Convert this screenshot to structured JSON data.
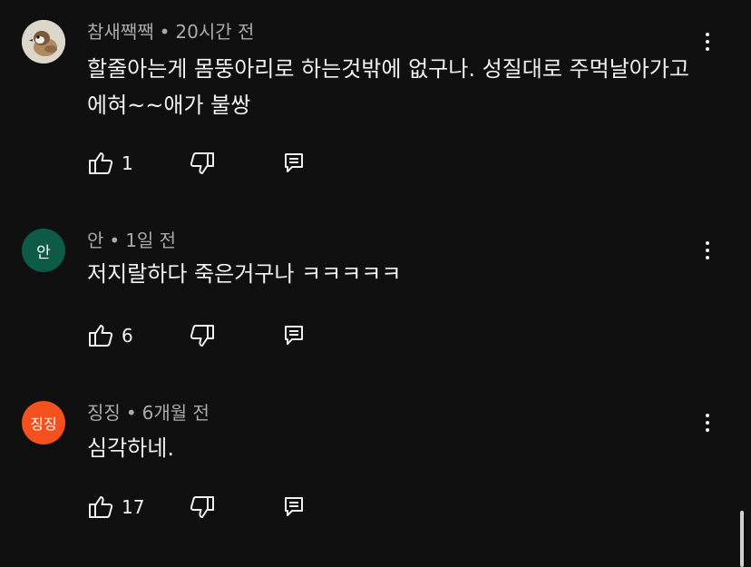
{
  "comments": [
    {
      "author": "참새짹짹",
      "time": "20시간 전",
      "text": "할줄아는게 몸뚱아리로 하는것밖에 없구나. 성질대로 주먹날아가고 에혀~~애가 불쌍",
      "likes": "1",
      "avatar": {
        "type": "image",
        "icon": "sparrow-photo",
        "bg": "#d8d0c4"
      }
    },
    {
      "author": "안",
      "time": "1일 전",
      "text": "저지랄하다 죽은거구나 ㅋㅋㅋㅋㅋ",
      "likes": "6",
      "avatar": {
        "type": "initials",
        "initials": "안",
        "bg": "#0d5a47"
      }
    },
    {
      "author": "징징",
      "time": "6개월 전",
      "text": "심각하네.",
      "likes": "17",
      "avatar": {
        "type": "initials",
        "initials": "징징",
        "bg": "#f4511e"
      }
    }
  ],
  "separator": "•",
  "icons": {
    "like": "thumbs-up-icon",
    "dislike": "thumbs-down-icon",
    "reply": "reply-comment-icon",
    "more": "more-vert-icon"
  },
  "colors": {
    "background": "#0f0f0f",
    "text_primary": "#f1f1f1",
    "text_secondary": "#aaaaaa"
  }
}
